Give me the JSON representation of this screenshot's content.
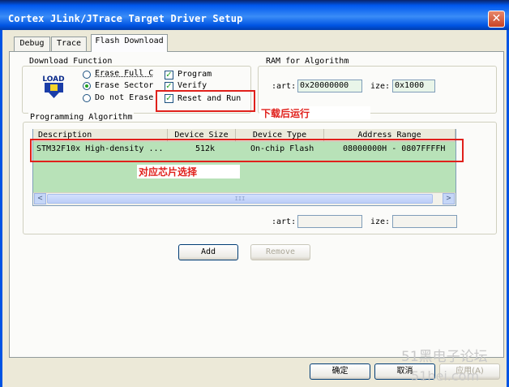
{
  "window": {
    "title": "Cortex JLink/JTrace Target Driver Setup",
    "close_glyph": "✕"
  },
  "tabs": [
    {
      "label": "Debug"
    },
    {
      "label": "Trace"
    },
    {
      "label": "Flash Download"
    }
  ],
  "download_function": {
    "legend": "Download Function",
    "load_icon_text": "LOAD",
    "radios": [
      {
        "label": "Erase Full C",
        "selected": false
      },
      {
        "label": "Erase Sector",
        "selected": true
      },
      {
        "label": "Do not Erase",
        "selected": false
      }
    ],
    "checkboxes": [
      {
        "label": "Program",
        "checked": true
      },
      {
        "label": "Verify",
        "checked": true
      },
      {
        "label": "Reset and Run",
        "checked": true
      }
    ]
  },
  "ram": {
    "legend": "RAM for Algorithm",
    "start_label": ":art:",
    "start_value": "0x20000000",
    "size_label": "ize:",
    "size_value": "0x1000"
  },
  "programming": {
    "legend": "Programming Algorithm",
    "columns": [
      "Description",
      "Device Size",
      "Device Type",
      "Address Range"
    ],
    "rows": [
      {
        "description": "STM32F10x High-density ...",
        "size": "512k",
        "type": "On-chip Flash",
        "range": "08000000H - 0807FFFFH"
      }
    ],
    "start_label": ":art:",
    "size_label": "ize:",
    "scroll_left": "<",
    "scroll_right": ">",
    "scroll_grip": "III"
  },
  "buttons": {
    "add": "Add",
    "remove": "Remove",
    "ok": "确定",
    "cancel": "取消",
    "apply": "应用(A)"
  },
  "annotations": {
    "reset_run": "下载后运行",
    "chip": "对应芯片选择"
  },
  "watermark": {
    "line1": "51黑电子论坛",
    "line2": "51hei.com"
  },
  "colors": {
    "accent": "#0054e3",
    "annotation_red": "#e0201b",
    "selected_row": "#b8e2b8"
  }
}
